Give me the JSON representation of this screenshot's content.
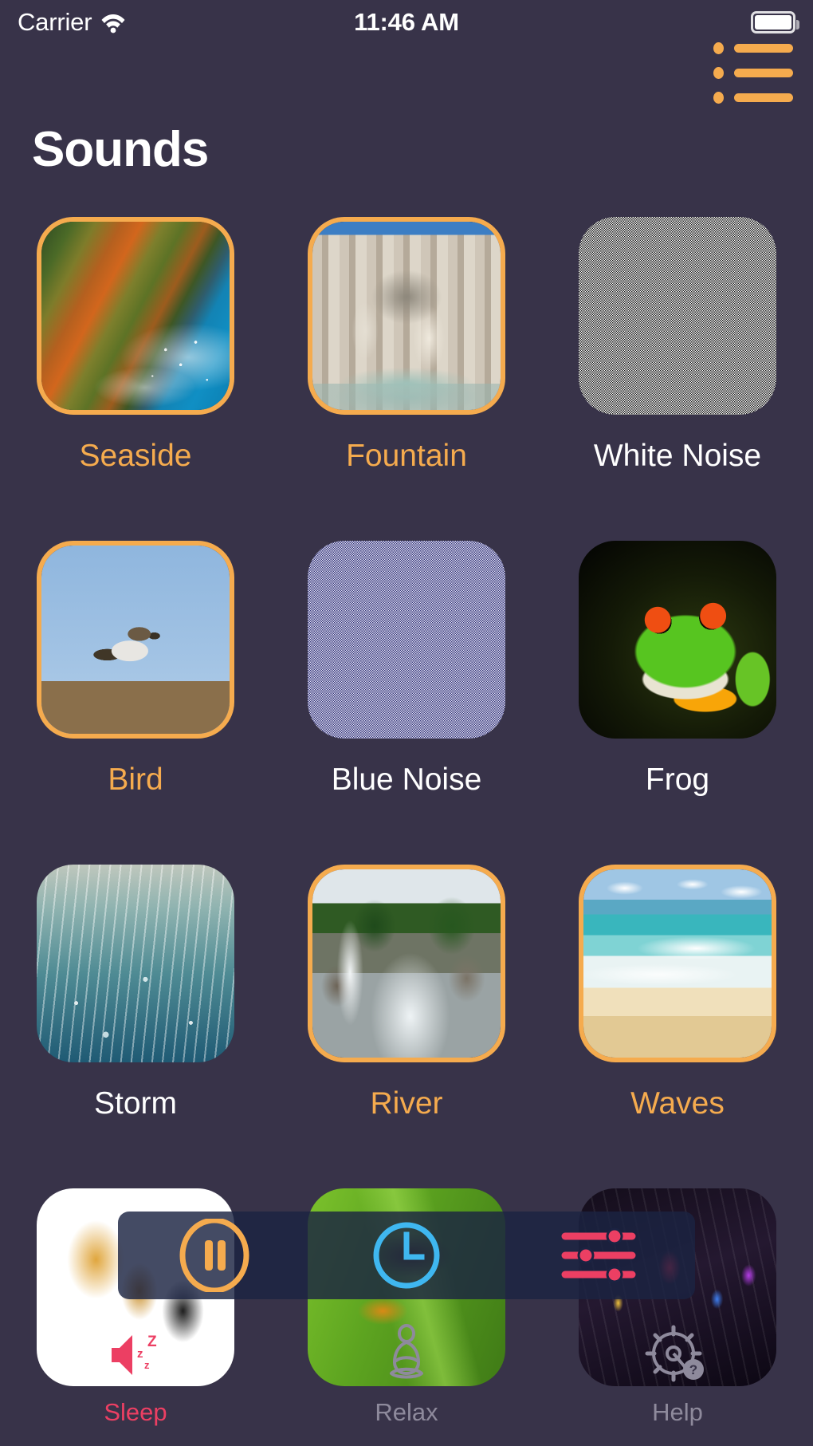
{
  "theme": {
    "background": "#383349",
    "accent": "#f5ab4e",
    "active_tab": "#ec3f63",
    "timer_blue": "#3fb7f0",
    "overlay": "#1b2342"
  },
  "status_bar": {
    "carrier": "Carrier",
    "wifi_icon": "wifi-icon",
    "time": "11:46 AM",
    "battery_icon": "battery-full-icon"
  },
  "header": {
    "title": "Sounds",
    "menu_icon": "list-menu-icon"
  },
  "sounds": [
    {
      "label": "Seaside",
      "art": "seaside",
      "selected": true
    },
    {
      "label": "Fountain",
      "art": "fountain",
      "selected": true
    },
    {
      "label": "White Noise",
      "art": "whitenoise",
      "selected": false
    },
    {
      "label": "Bird",
      "art": "bird",
      "selected": true
    },
    {
      "label": "Blue Noise",
      "art": "bluenoise",
      "selected": false
    },
    {
      "label": "Frog",
      "art": "frog",
      "selected": false
    },
    {
      "label": "Storm",
      "art": "storm",
      "selected": false
    },
    {
      "label": "River",
      "art": "river",
      "selected": true
    },
    {
      "label": "Waves",
      "art": "waves",
      "selected": true
    },
    {
      "label": "",
      "art": "trumpet",
      "selected": false
    },
    {
      "label": "",
      "art": "cricket",
      "selected": false
    },
    {
      "label": "",
      "art": "city",
      "selected": false
    }
  ],
  "player": {
    "pause_icon": "pause-circle-icon",
    "timer_icon": "clock-icon",
    "mixer_icon": "sliders-icon"
  },
  "tabs": [
    {
      "label": "Sleep",
      "icon": "speaker-sleep-icon",
      "active": true
    },
    {
      "label": "Relax",
      "icon": "meditation-icon",
      "active": false
    },
    {
      "label": "Help",
      "icon": "gear-question-icon",
      "active": false
    }
  ]
}
